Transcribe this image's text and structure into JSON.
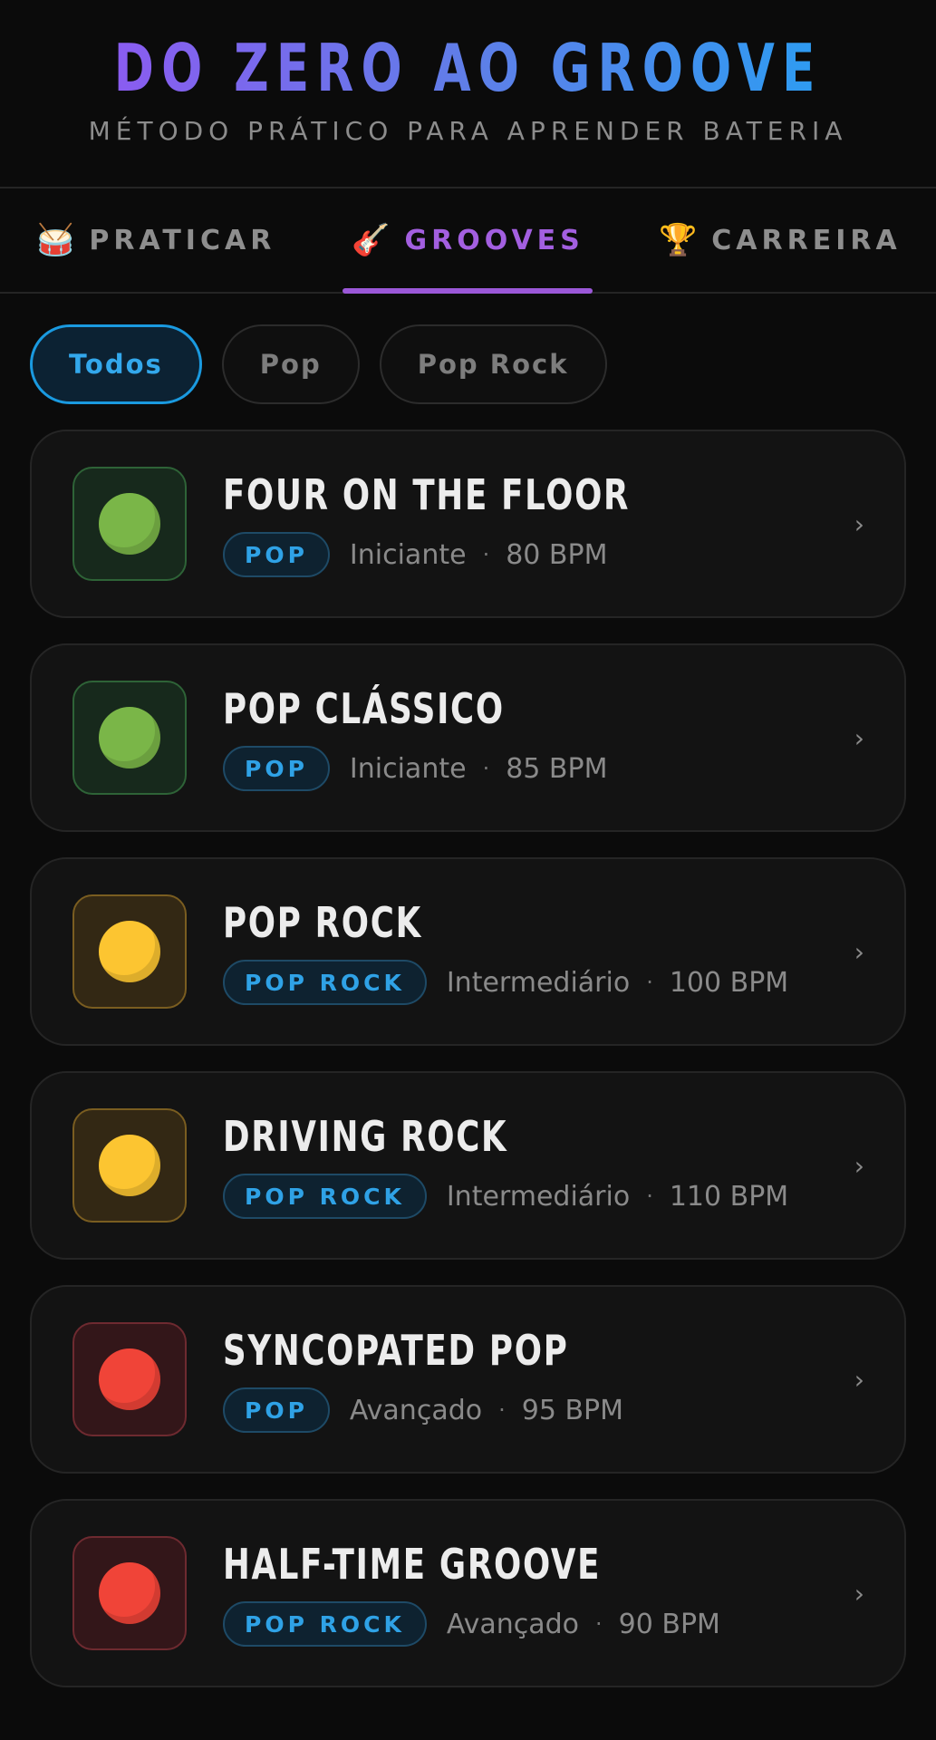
{
  "header": {
    "title": "DO ZERO AO GROOVE",
    "subtitle": "MÉTODO PRÁTICO PARA APRENDER BATERIA"
  },
  "tabs": [
    {
      "icon": "🥁",
      "label": "PRATICAR",
      "active": false
    },
    {
      "icon": "🎸",
      "label": "GROOVES",
      "active": true
    },
    {
      "icon": "🏆",
      "label": "CARREIRA",
      "active": false
    }
  ],
  "filters": [
    {
      "label": "Todos",
      "active": true
    },
    {
      "label": "Pop",
      "active": false
    },
    {
      "label": "Pop Rock",
      "active": false
    }
  ],
  "colors": {
    "beginner": {
      "dot": "#7ab648",
      "bg": "#17291c",
      "border": "#2e6337"
    },
    "intermediate": {
      "dot": "#fcc531",
      "bg": "#332814",
      "border": "#7a5d20"
    },
    "advanced": {
      "dot": "#f04438",
      "bg": "#331619",
      "border": "#6e2a30"
    }
  },
  "grooves": [
    {
      "title": "FOUR ON THE FLOOR",
      "genre": "POP",
      "level": "Iniciante",
      "bpm": "80 BPM",
      "level_key": "beginner"
    },
    {
      "title": "POP CLÁSSICO",
      "genre": "POP",
      "level": "Iniciante",
      "bpm": "85 BPM",
      "level_key": "beginner"
    },
    {
      "title": "POP ROCK",
      "genre": "POP ROCK",
      "level": "Intermediário",
      "bpm": "100 BPM",
      "level_key": "intermediate"
    },
    {
      "title": "DRIVING ROCK",
      "genre": "POP ROCK",
      "level": "Intermediário",
      "bpm": "110 BPM",
      "level_key": "intermediate"
    },
    {
      "title": "SYNCOPATED POP",
      "genre": "POP",
      "level": "Avançado",
      "bpm": "95 BPM",
      "level_key": "advanced"
    },
    {
      "title": "HALF-TIME GROOVE",
      "genre": "POP ROCK",
      "level": "Avançado",
      "bpm": "90 BPM",
      "level_key": "advanced"
    }
  ],
  "separator": "·",
  "chevron": "›"
}
